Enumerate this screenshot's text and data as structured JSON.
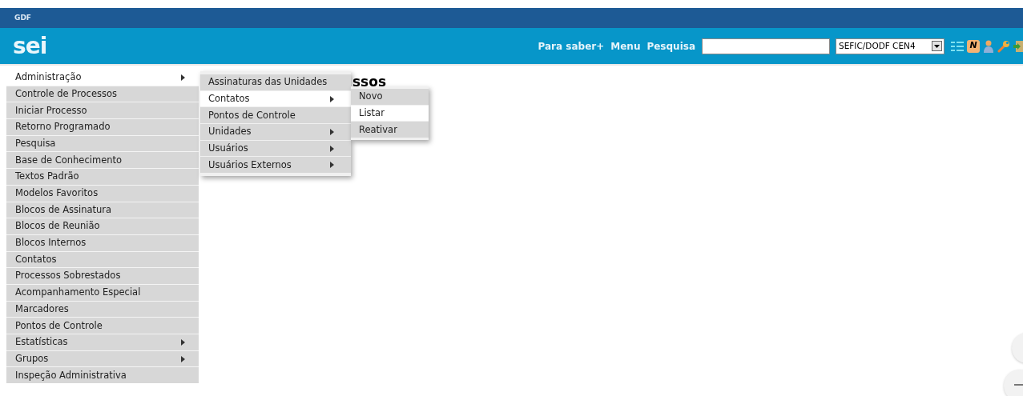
{
  "top_bar": {
    "label": "GDF"
  },
  "header": {
    "logo": "sei",
    "links": [
      "Para saber+",
      "Menu",
      "Pesquisa"
    ],
    "unit_select": {
      "value": "SEFIC/DODF CEN4"
    },
    "badge_icon_letter": "N"
  },
  "page_title": "ssos",
  "main_menu": [
    {
      "label": "Administração",
      "highlighted": true,
      "submenu": true
    },
    {
      "label": "Controle de Processos",
      "highlighted": false,
      "submenu": false
    },
    {
      "label": "Iniciar Processo",
      "highlighted": false,
      "submenu": false
    },
    {
      "label": "Retorno Programado",
      "highlighted": false,
      "submenu": false
    },
    {
      "label": "Pesquisa",
      "highlighted": false,
      "submenu": false
    },
    {
      "label": "Base de Conhecimento",
      "highlighted": false,
      "submenu": false
    },
    {
      "label": "Textos Padrão",
      "highlighted": false,
      "submenu": false
    },
    {
      "label": "Modelos Favoritos",
      "highlighted": false,
      "submenu": false
    },
    {
      "label": "Blocos de Assinatura",
      "highlighted": false,
      "submenu": false
    },
    {
      "label": "Blocos de Reunião",
      "highlighted": false,
      "submenu": false
    },
    {
      "label": "Blocos Internos",
      "highlighted": false,
      "submenu": false
    },
    {
      "label": "Contatos",
      "highlighted": false,
      "submenu": false
    },
    {
      "label": "Processos Sobrestados",
      "highlighted": false,
      "submenu": false
    },
    {
      "label": "Acompanhamento Especial",
      "highlighted": false,
      "submenu": false
    },
    {
      "label": "Marcadores",
      "highlighted": false,
      "submenu": false
    },
    {
      "label": "Pontos de Controle",
      "highlighted": false,
      "submenu": false
    },
    {
      "label": "Estatísticas",
      "highlighted": false,
      "submenu": true
    },
    {
      "label": "Grupos",
      "highlighted": false,
      "submenu": true
    },
    {
      "label": "Inspeção Administrativa",
      "highlighted": false,
      "submenu": false
    }
  ],
  "submenu": [
    {
      "label": "Assinaturas das Unidades",
      "highlighted": false,
      "submenu": false
    },
    {
      "label": "Contatos",
      "highlighted": true,
      "submenu": true
    },
    {
      "label": "Pontos de Controle",
      "highlighted": false,
      "submenu": false
    },
    {
      "label": "Unidades",
      "highlighted": false,
      "submenu": true
    },
    {
      "label": "Usuários",
      "highlighted": false,
      "submenu": true
    },
    {
      "label": "Usuários Externos",
      "highlighted": false,
      "submenu": true
    }
  ],
  "submenu_2": [
    {
      "label": "Novo",
      "highlighted": false,
      "submenu": false
    },
    {
      "label": "Listar",
      "highlighted": true,
      "submenu": false
    },
    {
      "label": "Reativar",
      "highlighted": false,
      "submenu": false
    }
  ]
}
